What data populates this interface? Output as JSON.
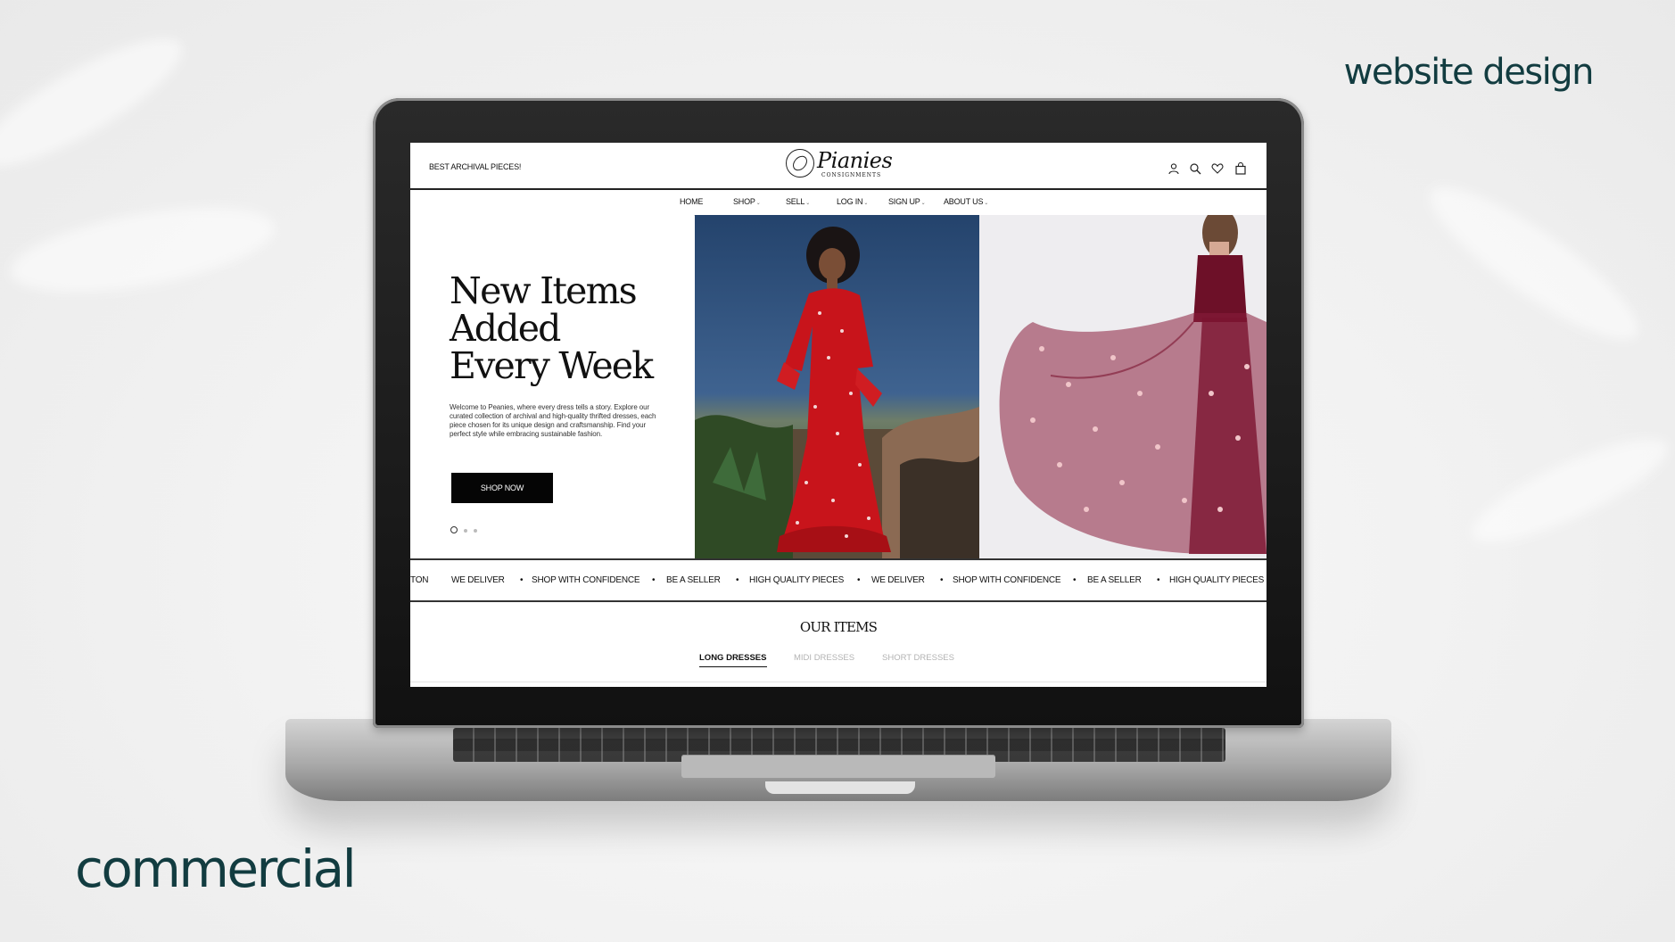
{
  "labels": {
    "top_right": "website design",
    "bottom_left": "commercial"
  },
  "site": {
    "promo": "BEST ARCHIVAL PIECES!",
    "logo": {
      "name": "Pianies",
      "sub": "CONSIGNMENTS"
    },
    "header_icons": [
      "user-icon",
      "search-icon",
      "heart-icon",
      "bag-icon"
    ],
    "nav": [
      {
        "label": "HOME"
      },
      {
        "label": "SHOP"
      },
      {
        "label": "SELL"
      },
      {
        "label": "LOG IN"
      },
      {
        "label": "SIGN UP"
      },
      {
        "label": "ABOUT US"
      }
    ],
    "nav_caret": "⌄"
  },
  "hero": {
    "title": "New Items\nAdded\nEvery Week",
    "text": "Welcome to Peanies, where every dress tells a story. Explore our curated collection of archival and high-quality thrifted dresses, each piece chosen for its unique design and craftsmanship. Find your perfect style while embracing sustainable fashion.",
    "button": "SHOP NOW",
    "slides": 3,
    "active_slide": 1
  },
  "ticker": {
    "items": [
      "TON",
      "WE DELIVER",
      "SHOP WITH CONFIDENCE",
      "BE A SELLER",
      "HIGH QUALITY PIECES",
      "WE DELIVER",
      "SHOP WITH CONFIDENCE",
      "BE A SELLER",
      "HIGH QUALITY PIECES"
    ],
    "separator": "•"
  },
  "items": {
    "title": "OUR ITEMS",
    "tabs": [
      {
        "label": "LONG DRESSES",
        "active": true
      },
      {
        "label": "MIDI DRESSES",
        "active": false
      },
      {
        "label": "SHORT DRESSES",
        "active": false
      }
    ]
  },
  "colors": {
    "brand": "#123c40",
    "button": "#050505",
    "dress1": "#c8141b",
    "dress2": "#7b1430"
  }
}
